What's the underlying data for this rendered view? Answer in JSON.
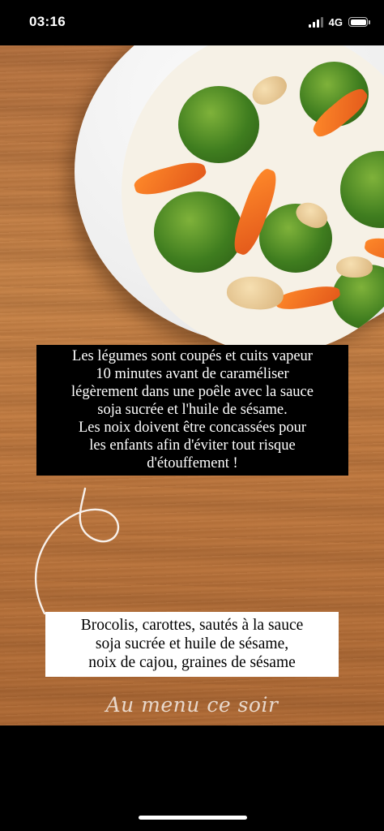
{
  "status_bar": {
    "time": "03:16",
    "network": "4G"
  },
  "story": {
    "caption_black": [
      "Les légumes sont coupés et cuits vapeur",
      "10 minutes avant de caraméliser",
      "légèrement dans une poêle avec la sauce",
      "soja sucrée et l'huile de sésame.",
      "Les noix doivent être concassées pour",
      "les enfants afin d'éviter tout risque",
      "d'étouffement !"
    ],
    "caption_white": [
      "Brocolis, carottes, sautés à la sauce",
      "soja sucrée et huile de sésame,",
      "noix de cajou, graines de sésame"
    ],
    "script_title": "Au menu ce soir"
  },
  "colors": {
    "wood": "#c27a3f",
    "broccoli": "#3f7d1f",
    "carrot": "#e2571a"
  }
}
